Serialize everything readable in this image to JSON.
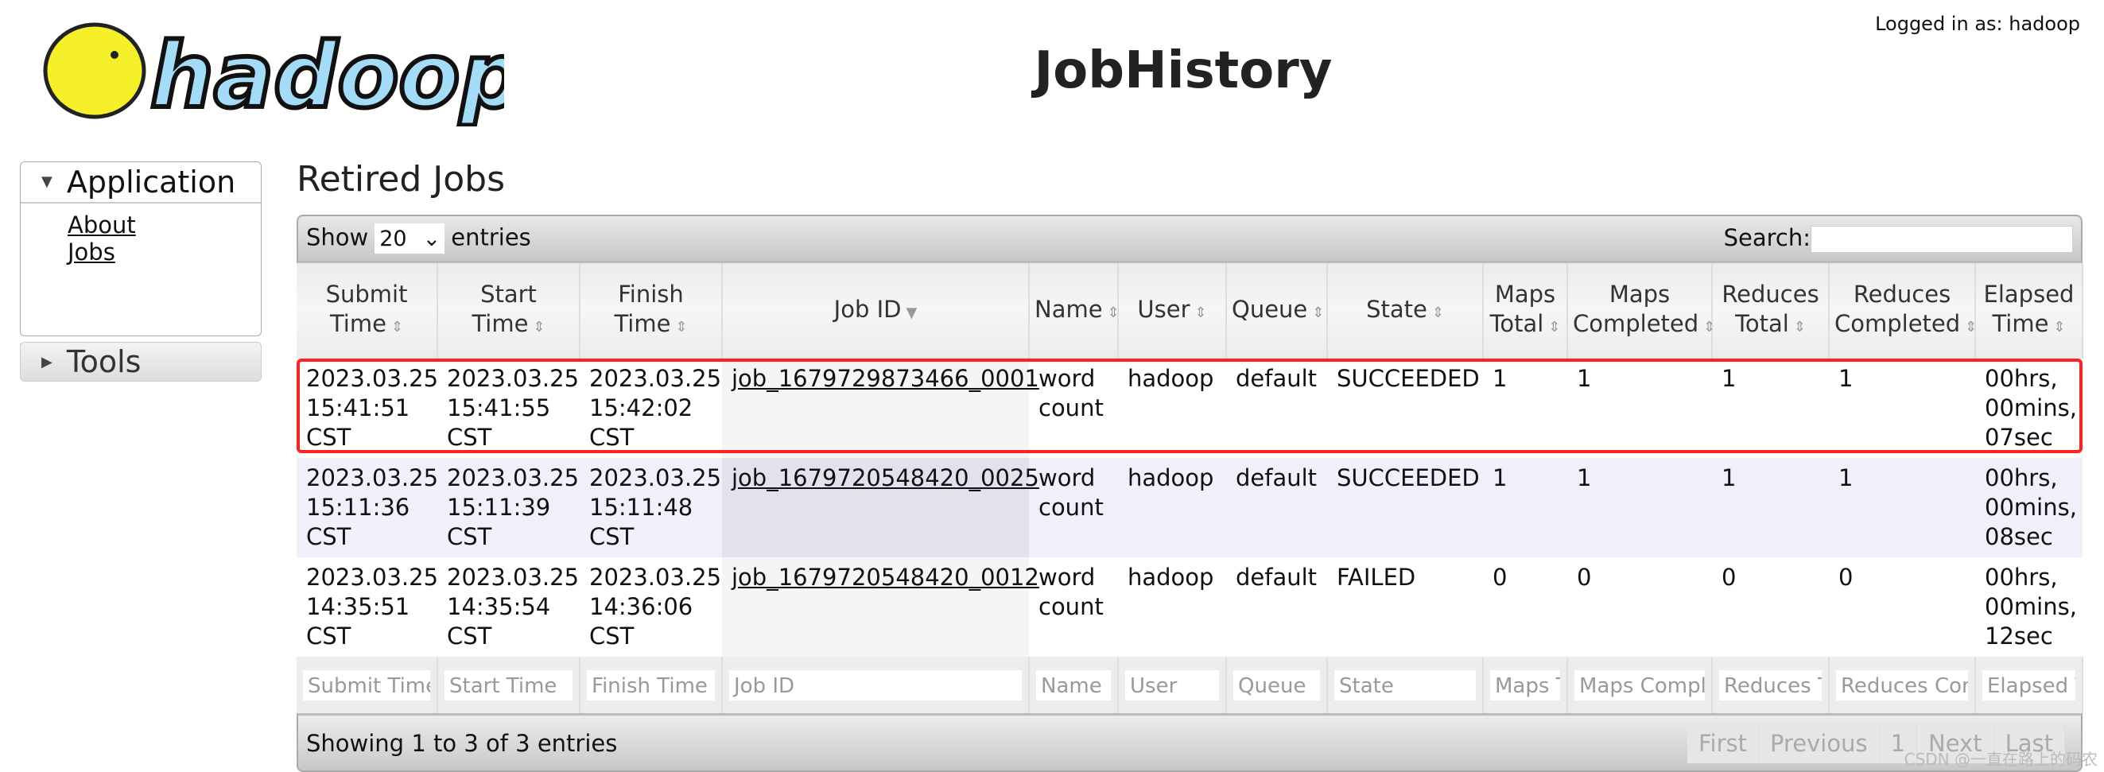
{
  "header": {
    "logo_text": "hadoop",
    "title": "JobHistory",
    "logged_in": "Logged in as: hadoop"
  },
  "sidebar": {
    "application": "Application",
    "links": [
      "About",
      "Jobs"
    ],
    "tools": "Tools"
  },
  "main": {
    "heading": "Retired Jobs",
    "show_label": "Show",
    "entries_value": "20",
    "entries_label": "entries",
    "search_label": "Search:",
    "search_value": "",
    "columns": [
      "Submit Time",
      "Start Time",
      "Finish Time",
      "Job ID",
      "Name",
      "User",
      "Queue",
      "State",
      "Maps Total",
      "Maps Completed",
      "Reduces Total",
      "Reduces Completed",
      "Elapsed Time"
    ],
    "rows": [
      [
        "2023.03.25 15:41:51 CST",
        "2023.03.25 15:41:55 CST",
        "2023.03.25 15:42:02 CST",
        "job_1679729873466_0001",
        "word count",
        "hadoop",
        "default",
        "SUCCEEDED",
        "1",
        "1",
        "1",
        "1",
        "00hrs, 00mins, 07sec"
      ],
      [
        "2023.03.25 15:11:36 CST",
        "2023.03.25 15:11:39 CST",
        "2023.03.25 15:11:48 CST",
        "job_1679720548420_0025",
        "word count",
        "hadoop",
        "default",
        "SUCCEEDED",
        "1",
        "1",
        "1",
        "1",
        "00hrs, 00mins, 08sec"
      ],
      [
        "2023.03.25 14:35:51 CST",
        "2023.03.25 14:35:54 CST",
        "2023.03.25 14:36:06 CST",
        "job_1679720548420_0012",
        "word count",
        "hadoop",
        "default",
        "FAILED",
        "0",
        "0",
        "0",
        "0",
        "00hrs, 00mins, 12sec"
      ]
    ],
    "filters": [
      "Submit Time",
      "Start Time",
      "Finish Time",
      "Job ID",
      "Name",
      "User",
      "Queue",
      "State",
      "Maps Total",
      "Maps Completed",
      "Reduces Total",
      "Reduces Completed",
      "Elapsed Time"
    ],
    "info": "Showing 1 to 3 of 3 entries",
    "pagination": [
      "First",
      "Previous",
      "1",
      "Next",
      "Last"
    ],
    "highlight_color": "#ff2222"
  },
  "watermark": "CSDN @一直在路上的码农"
}
